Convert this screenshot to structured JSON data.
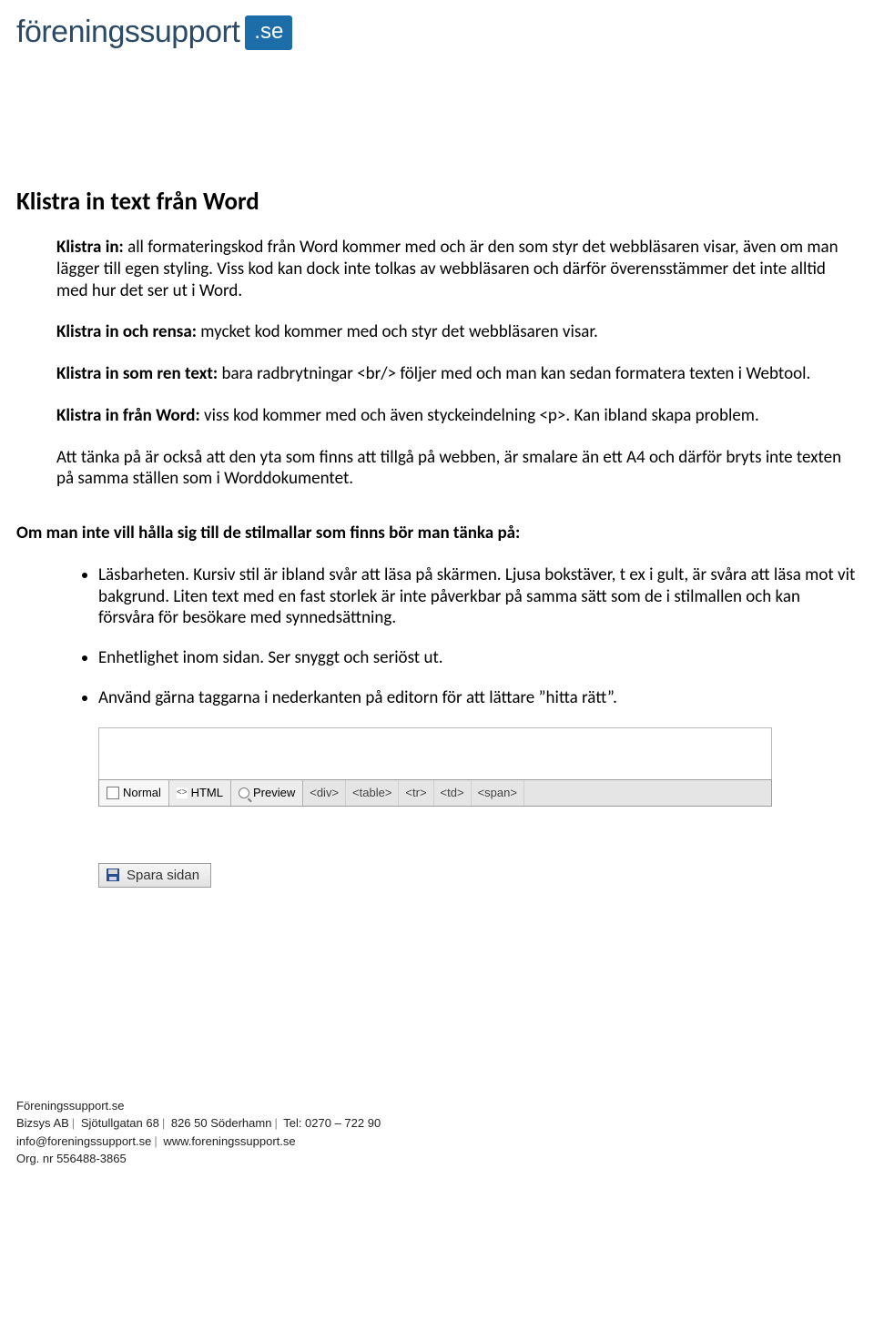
{
  "logo": {
    "text": "föreningssupport",
    "badge": ".se"
  },
  "title": "Klistra in text från Word",
  "p1": {
    "b": "Klistra in:",
    "t": " all formateringskod från Word kommer med och är den som styr det webbläsaren visar, även om man lägger till egen styling. Viss kod kan dock inte tolkas av webbläsaren och därför överensstämmer det inte alltid med hur det ser ut i Word."
  },
  "p2": {
    "b": "Klistra in och rensa:",
    "t": " mycket kod kommer med och styr det webbläsaren visar."
  },
  "p3": {
    "b": "Klistra in som ren text:",
    "t": " bara radbrytningar <br/> följer med och man kan sedan formatera texten i Webtool."
  },
  "p4": {
    "b": "Klistra in från Word:",
    "t": " viss kod kommer med och även styckeindelning <p>. Kan ibland skapa problem."
  },
  "p5": "Att tänka på är också att den yta som finns att tillgå på webben, är smalare än ett A4 och därför bryts inte texten på samma ställen som i Worddokumentet.",
  "list_heading": "Om man inte vill hålla sig till de stilmallar som finns bör man tänka på:",
  "bullets": [
    "Läsbarheten. Kursiv stil är ibland svår att läsa på skärmen. Ljusa bokstäver, t ex i gult, är svåra att läsa mot vit bakgrund. Liten text med en fast storlek är inte påverkbar på samma sätt som de i stilmallen och kan försvåra för besökare med synnedsättning.",
    "Enhetlighet inom sidan. Ser snyggt och seriöst ut.",
    "Använd gärna taggarna i nederkanten på editorn för att lättare ”hitta rätt”."
  ],
  "editor": {
    "tabs": {
      "normal": "Normal",
      "html": "HTML",
      "preview": "Preview"
    },
    "tags": [
      "<div>",
      "<table>",
      "<tr>",
      "<td>",
      "<span>"
    ]
  },
  "save_label": "Spara sidan",
  "footer": {
    "line1": "Föreningssupport.se",
    "company": "Bizsys AB",
    "street": "Sjötullgatan 68",
    "zipcity": "826 50 Söderhamn",
    "tel": "Tel: 0270 – 722 90",
    "email": "info@foreningssupport.se",
    "web": "www.foreningssupport.se",
    "org": "Org. nr 556488-3865"
  }
}
